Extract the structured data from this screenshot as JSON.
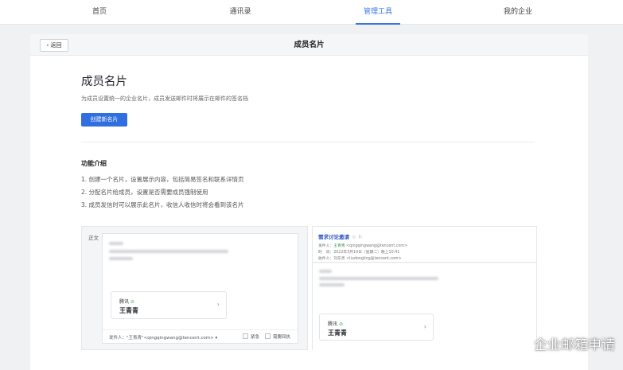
{
  "nav": {
    "tabs": [
      {
        "label": "首页",
        "active": false
      },
      {
        "label": "通讯录",
        "active": false
      },
      {
        "label": "管理工具",
        "active": true
      },
      {
        "label": "我的企业",
        "active": false
      }
    ],
    "accent_color": "#3a75e0"
  },
  "header": {
    "back_label": "返回",
    "title": "成员名片"
  },
  "main": {
    "heading": "成员名片",
    "description": "为成员设置统一的企业名片，成员发送邮件时将展示在邮件的签名档",
    "create_button": "创建新名片",
    "features_title": "功能介绍",
    "features": [
      "1. 创建一个名片，设置展示内容，包括简易签名和联系详情页",
      "2. 分配名片给成员，设置是否需要成员强制使用",
      "3. 成员发信时可以展示此名片，收信人收信时将会看到该名片"
    ]
  },
  "preview_compose": {
    "body_label": "正文",
    "card_company": "腾讯",
    "card_person": "王青青",
    "sender_line": "发件人：\"王青青\"<qingqingwang@tencent.com>",
    "urgent_label": "紧急",
    "receipt_label": "需要回执"
  },
  "preview_received": {
    "subject": "需求讨论邀请",
    "subject_icons": "☆ ⚐",
    "sender_prefix": "发件人：",
    "sender_name": "王青青",
    "sender_email": "<qingqingwang@tencent.com>",
    "time_line": "时　间：2022年3月10日（星期二）晚上10:41",
    "recipient_line": "收件人：刘东灵 <liudongling@tencent.com>",
    "card_company": "腾讯",
    "card_person": "王青青"
  },
  "watermark": {
    "text": "企业邮箱申请"
  }
}
